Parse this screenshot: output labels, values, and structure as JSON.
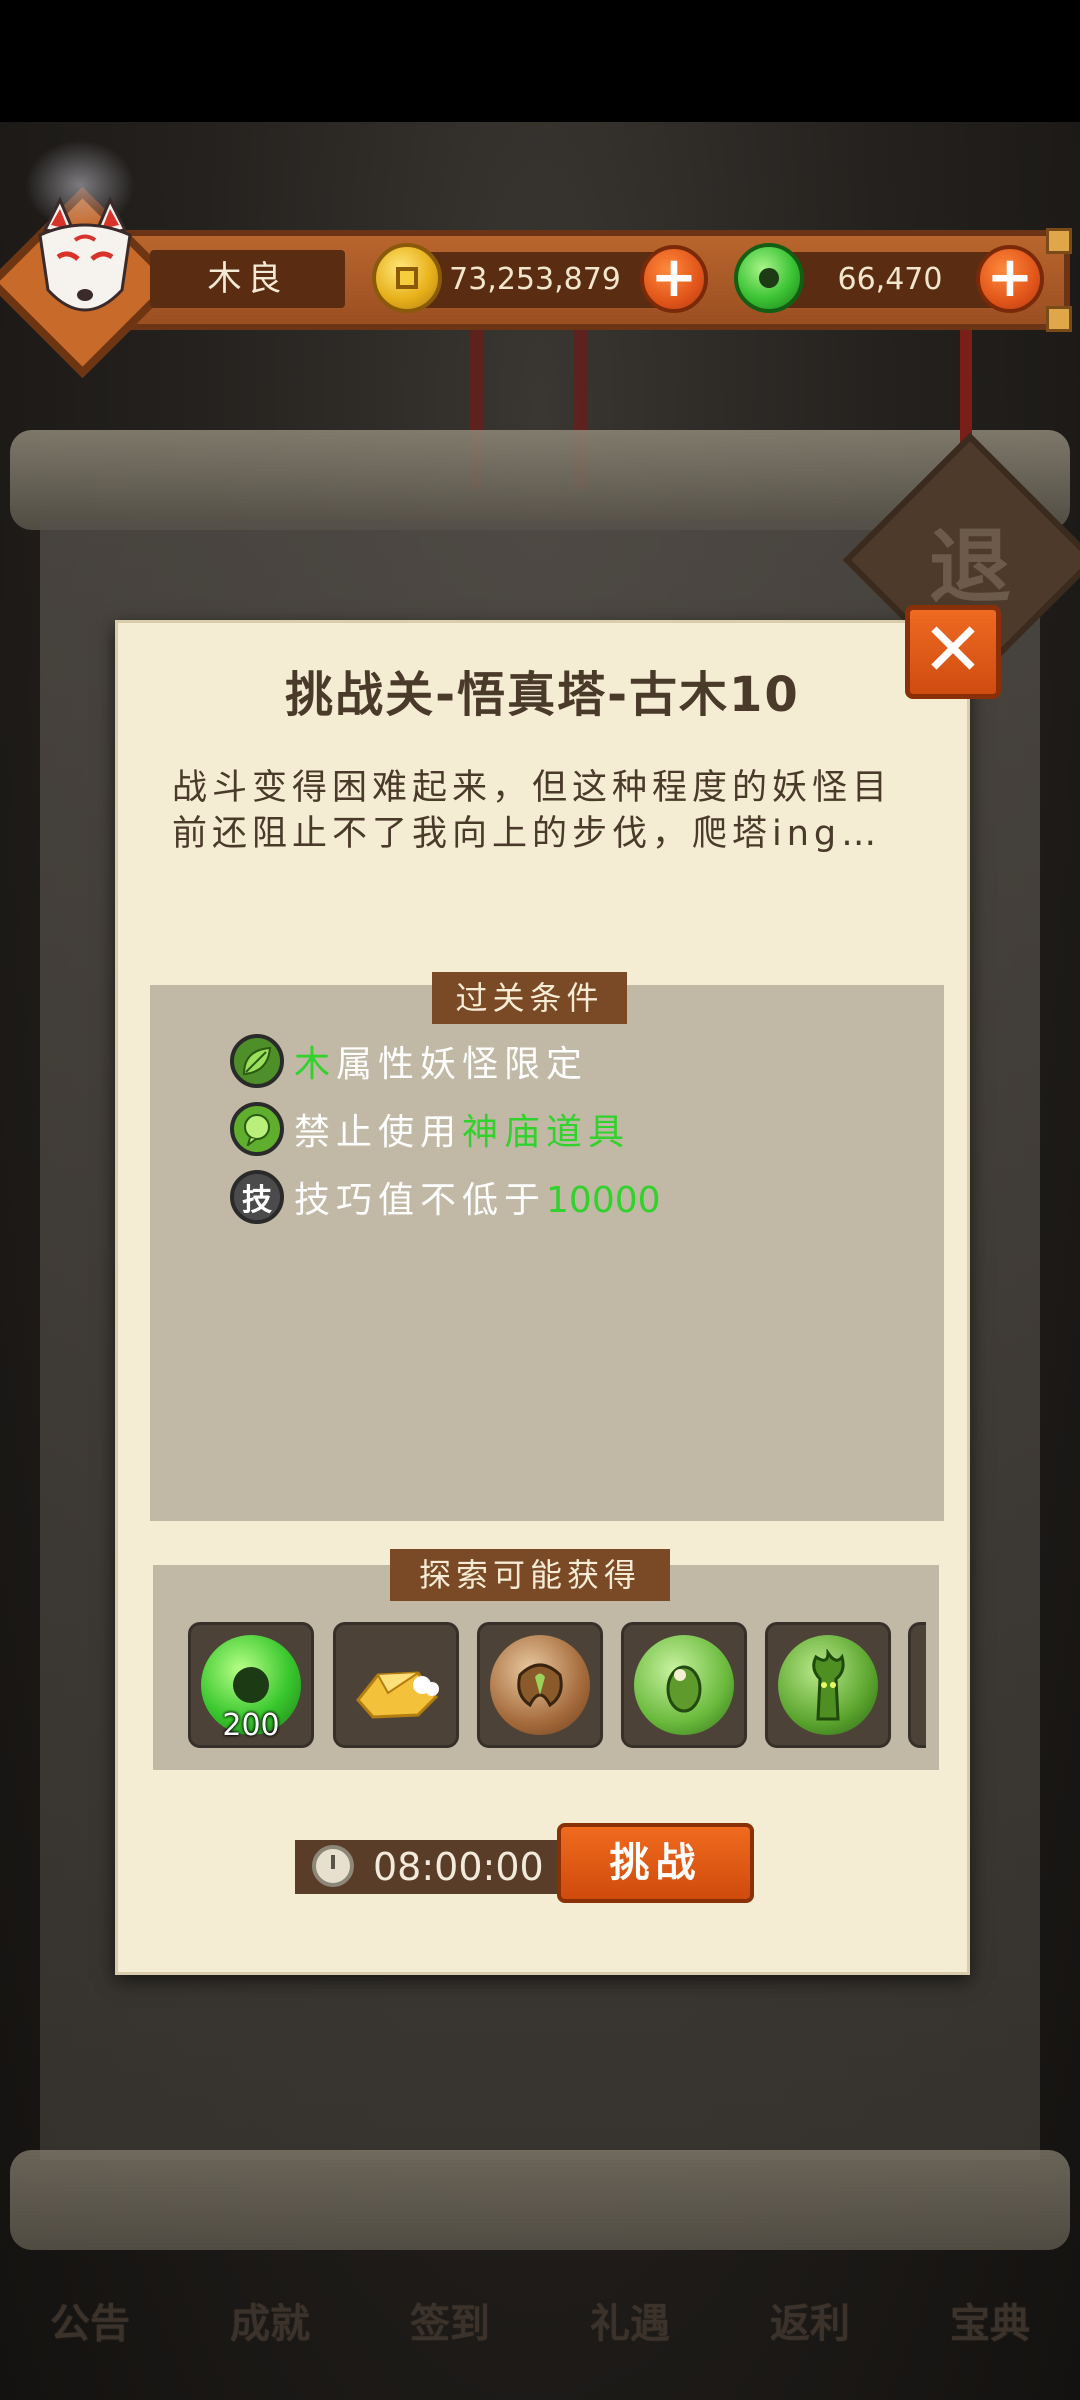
{
  "background": {
    "retreat_label": "退",
    "bottom_nav": [
      "公告",
      "成就",
      "签到",
      "礼遇",
      "返利",
      "宝典"
    ]
  },
  "top_bar": {
    "player_name": "木良",
    "gold_amount": "73,253,879",
    "jade_amount": "66,470",
    "plus_label": "+"
  },
  "dialog": {
    "title": "挑战关-悟真塔-古木10",
    "description": "战斗变得困难起来，但这种程度的妖怪目前还阻止不了我向上的步伐，爬塔ing…",
    "close_label": "✕",
    "conditions_header": "过关条件",
    "conditions": [
      {
        "icon": "leaf-icon",
        "highlight": "木",
        "text": "属性妖怪限定"
      },
      {
        "icon": "speech-icon",
        "text": "禁止使用",
        "highlight": "神庙道具"
      },
      {
        "icon_text": "技",
        "text": "技巧值不低于",
        "highlight": "10000"
      }
    ],
    "rewards_header": "探索可能获得",
    "rewards": [
      {
        "icon": "jade-coin-icon",
        "count": "200"
      },
      {
        "icon": "gold-ingot-icon"
      },
      {
        "icon": "brown-orb-icon"
      },
      {
        "icon": "green-bug-orb-icon"
      },
      {
        "icon": "tree-spirit-orb-icon"
      }
    ],
    "timer": "08:00:00",
    "challenge_label": "挑战"
  },
  "colors": {
    "highlight_green": "#31d22c",
    "accent_orange": "#e1551a"
  }
}
